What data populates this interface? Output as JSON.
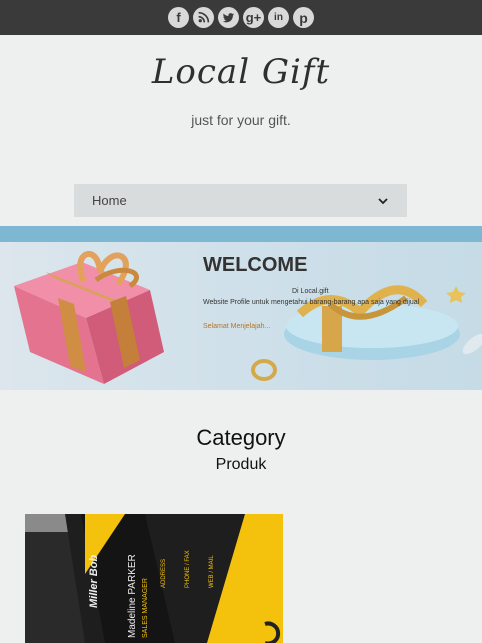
{
  "social": {
    "icons": [
      "facebook-icon",
      "rss-icon",
      "twitter-icon",
      "google-plus-icon",
      "linkedin-icon",
      "pinterest-icon"
    ],
    "glyphs": [
      "f",
      "",
      "",
      "g+",
      "in",
      "p"
    ]
  },
  "header": {
    "logo": "Local Gift",
    "tagline": "just for your gift."
  },
  "nav": {
    "selected": "Home"
  },
  "banner": {
    "title": "WELCOME",
    "line1": "Di Local.gift",
    "line2": "Website Profile untuk mengetahui barang-barang apa saja yang dijual",
    "link": "Selamat Menjelajah..."
  },
  "category": {
    "title": "Category",
    "subtitle": "Produk"
  },
  "product": {
    "card_name": "Miller Bob",
    "card_person": "Madeline PARKER",
    "card_role": "SALES MANAGER",
    "card_address_label": "ADDRESS",
    "card_phone_label": "PHONE / FAX",
    "card_web_label": "WEB / MAIL"
  },
  "colors": {
    "topbar": "#3a3a3a",
    "accent_bar": "#7db7d2",
    "card_yellow": "#f4c20d"
  }
}
